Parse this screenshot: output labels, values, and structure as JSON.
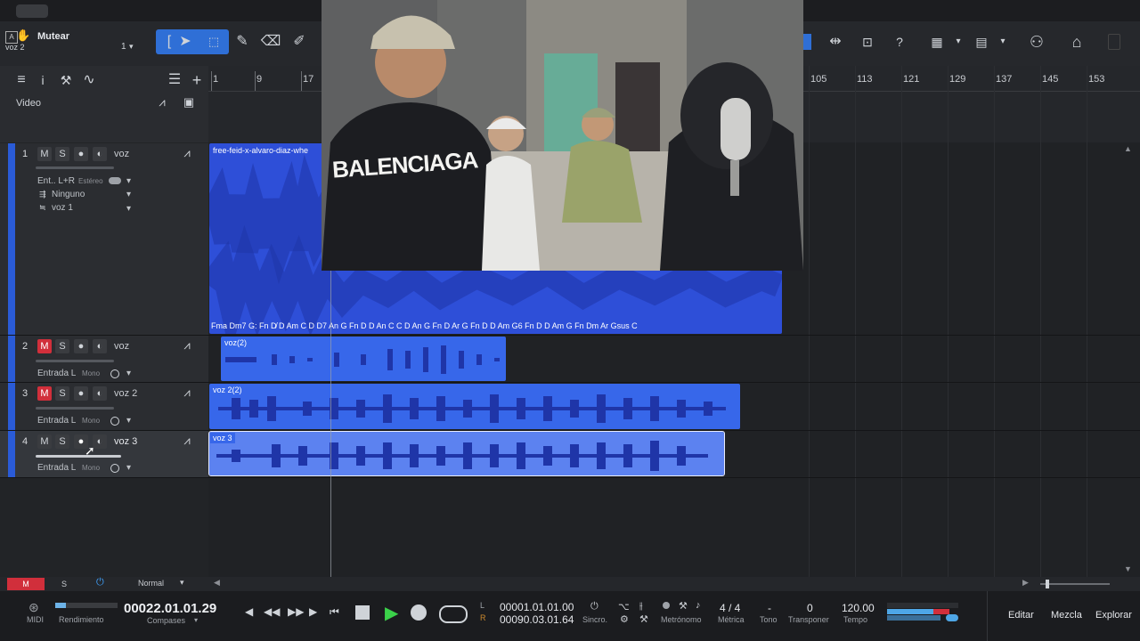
{
  "toolbar": {
    "track_label": "Mutear",
    "track_sub": "voz 2",
    "track_count": "1",
    "icons": [
      "hand-icon",
      "pointer-icon",
      "range-icon",
      "pencil-icon",
      "eraser-icon",
      "paint-icon",
      "help-icon",
      "grid-icon",
      "snap-icon",
      "user-icon",
      "home-icon"
    ]
  },
  "header": {
    "video_label": "Video"
  },
  "ruler": {
    "marks": [
      "1",
      "9",
      "17",
      "105",
      "113",
      "121",
      "129",
      "137",
      "145",
      "153"
    ]
  },
  "tracks": [
    {
      "num": "1",
      "name": "voz",
      "input": "Ent.. L+R",
      "input_mode": "Estéreo",
      "output": "Ninguno",
      "sub": "voz 1",
      "muted": false
    },
    {
      "num": "2",
      "name": "voz",
      "input": "Entrada L",
      "input_mode": "Mono",
      "muted": true
    },
    {
      "num": "3",
      "name": "voz 2",
      "input": "Entrada L",
      "input_mode": "Mono",
      "muted": true
    },
    {
      "num": "4",
      "name": "voz 3",
      "input": "Entrada L",
      "input_mode": "Mono",
      "muted": false
    }
  ],
  "buttons": {
    "m": "M",
    "s": "S"
  },
  "clips": {
    "c1": "free-feid-x-alvaro-diaz-whe",
    "c2": "voz(2)",
    "c3": "voz 2(2)",
    "c4": "voz 3"
  },
  "chords": "Fma  Dm7    G: Fn D̸ D Am  C D  D7  An  G  Fn  D  D  An   C C D  An  G   Fn  D   Ar  G   Fn  D  D Am  G6  Fn  D  D  Am   G   Fn  Dm  Ar  Gsus  C",
  "bottom": {
    "m_label": "M",
    "s_label": "S",
    "mode": "Normal"
  },
  "transport": {
    "midi": "MIDI",
    "rendimiento": "Rendimiento",
    "position": "00022.01.01.29",
    "pos_label": "Compases",
    "loop_l": "00001.01.01.00",
    "loop_r": "00090.03.01.64",
    "l": "L",
    "r": "R",
    "sincro": "Sincro.",
    "metronomo": "Metrónomo",
    "metrica_val": "4 / 4",
    "metrica": "Métrica",
    "tono_val": "-",
    "tono": "Tono",
    "transponer_val": "0",
    "transponer": "Transponer",
    "tempo_val": "120.00",
    "tempo": "Tempo",
    "editar": "Editar",
    "mezcla": "Mezcla",
    "explorar": "Explorar"
  },
  "overlay": {
    "shirt_text": "BALENCIAGA"
  }
}
